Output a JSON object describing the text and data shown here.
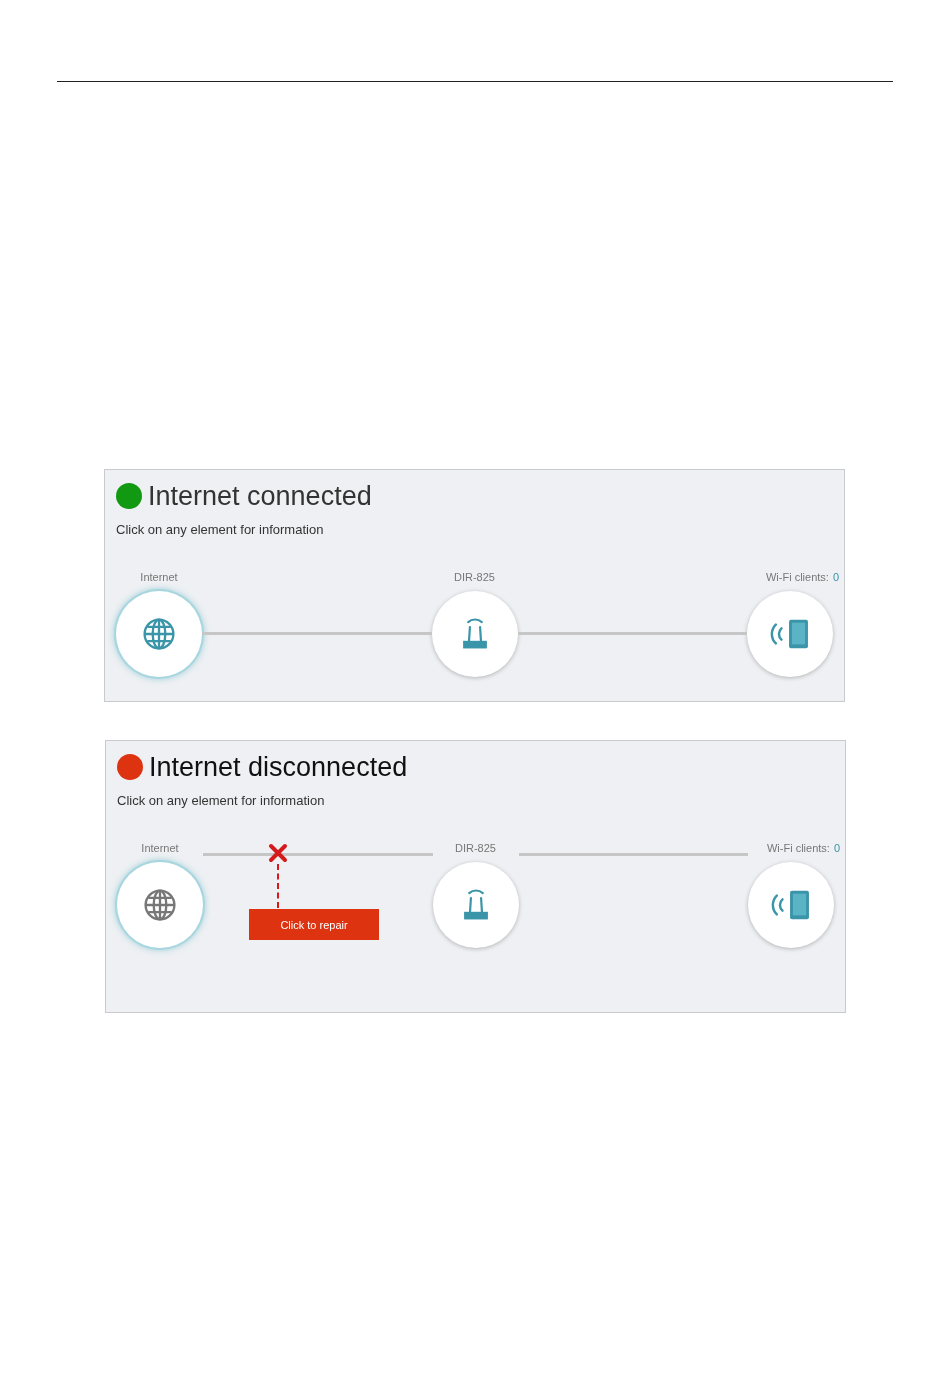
{
  "panels": [
    {
      "status": "Internet connected",
      "connected": true,
      "color": "#119911",
      "hint": "Click on any element for information",
      "nodes": [
        {
          "kind": "internet",
          "label": "Internet"
        },
        {
          "kind": "router",
          "label": "DIR-825"
        },
        {
          "kind": "clients",
          "label": "Wi-Fi clients:",
          "count": "0"
        }
      ]
    },
    {
      "status": "Internet disconnected",
      "connected": false,
      "color": "#dd3311",
      "hint": "Click on any element for information",
      "repair_button": "Click to repair",
      "nodes": [
        {
          "kind": "internet",
          "label": "Internet"
        },
        {
          "kind": "router",
          "label": "DIR-825"
        },
        {
          "kind": "clients",
          "label": "Wi-Fi clients:",
          "count": "0"
        }
      ]
    }
  ]
}
